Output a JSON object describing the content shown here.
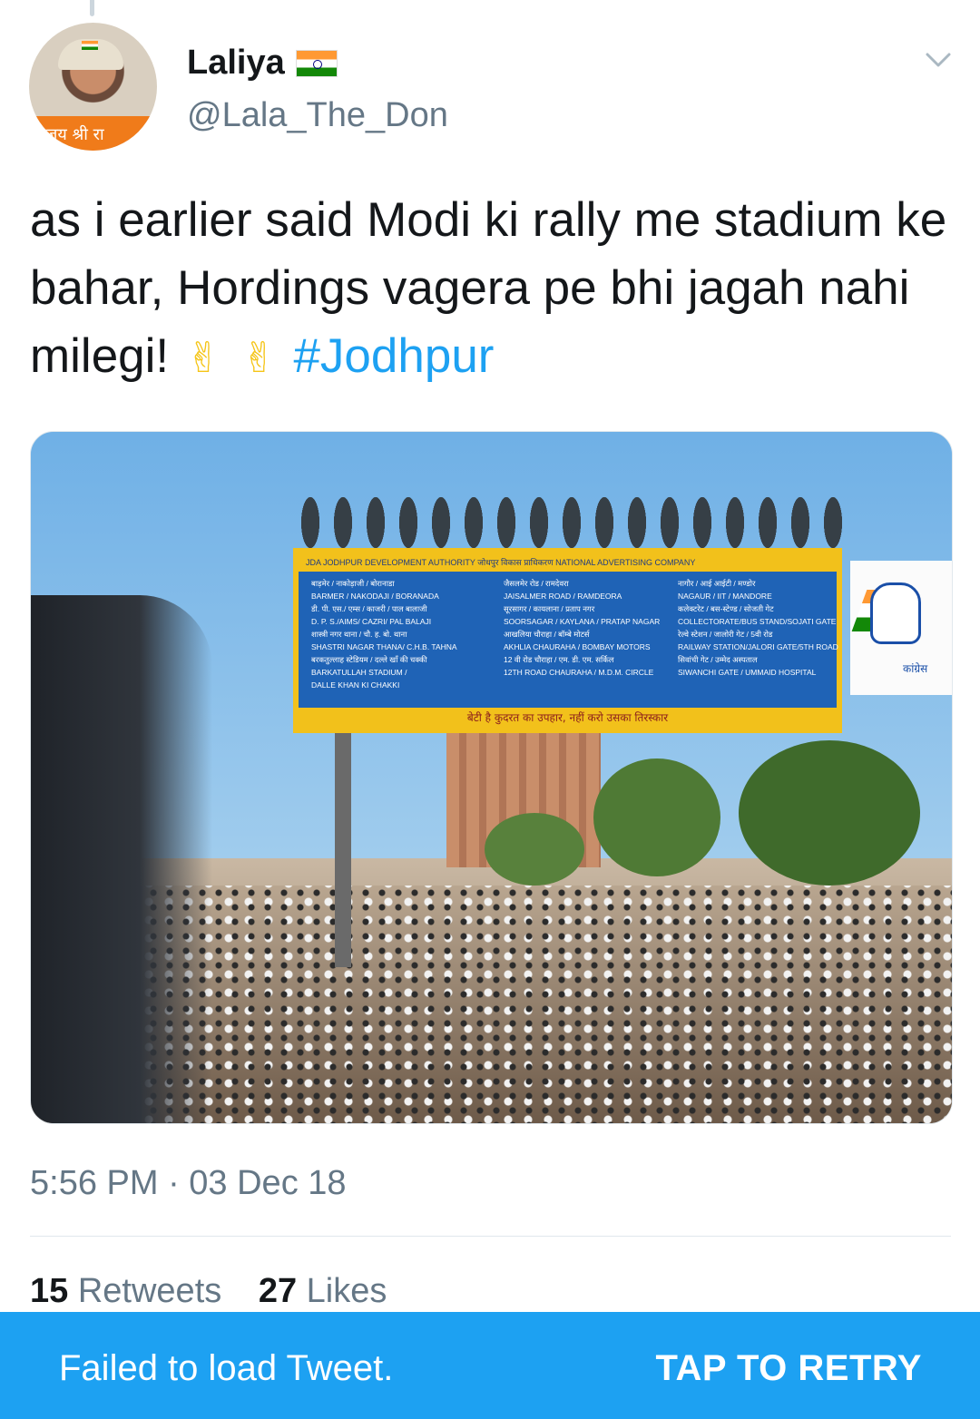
{
  "tweet": {
    "author": {
      "name": "Laliya",
      "handle": "@Lala_The_Don",
      "flag_icon": "india-flag-emoji",
      "avatar_band_text": "जय श्री रा"
    },
    "text_main": "as i earlier said Modi ki rally me stadium ke bahar, Hordings vagera pe bhi jagah nahi milegi!",
    "emoji_1": "✌",
    "emoji_2": "✌",
    "hashtag": "#Jodhpur",
    "timestamp": "5:56 PM · 03 Dec 18",
    "retweets_count": "15",
    "retweets_label": "Retweets",
    "likes_count": "27",
    "likes_label": "Likes"
  },
  "media": {
    "sign_header": "JDA  JODHPUR DEVELOPMENT AUTHORITY   जोधपुर विकास प्राधिकरण   NATIONAL ADVERTISING COMPANY",
    "sign_col1": [
      "बाड़मेर / नाकोड़ाजी / बोरानाडा",
      "BARMER / NAKODAJI / BORANADA",
      "डी. पी. एस./ एम्स / काजरी / पाल बालाजी",
      "D. P. S./AIMS/ CAZRI/ PAL  BALAJI",
      "शास्त्री नगर थाना / चौ. ह. बो. थाना",
      "SHASTRI NAGAR THANA/ C.H.B. TAHNA",
      "बरकतुल्लाह स्टेडियम / दल्ले खाँ की चक्की",
      "BARKATULLAH  STADIUM /",
      "DALLE  KHAN  KI  CHAKKI"
    ],
    "sign_col2": [
      "जैसलमेर रोड / रामदेवरा",
      "JAISALMER  ROAD / RAMDEORA",
      "सूरसागर / कायलाना / प्रताप नगर",
      "SOORSAGAR / KAYLANA / PRATAP NAGAR",
      "आखलिया चौराहा / बॉम्बे मोटर्स",
      "AKHLIA CHAURAHA / BOMBAY  MOTORS",
      "12 वी रोड चौराहा / एम. डी. एम. सर्किल",
      "12TH ROAD CHAURAHA / M.D.M. CIRCLE"
    ],
    "sign_col3": [
      "नागौर / आई आईटी / मण्डोर",
      "NAGAUR / IIT / MANDORE",
      "कलेक्टरेट / बस-स्टेण्ड / सोजती गेट",
      "COLLECTORATE/BUS STAND/SOJATI GATE",
      "रेल्वे स्टेशन / जालोरी गेट / 5वी रोड",
      "RAILWAY STATION/JALORI GATE/5TH ROAD",
      "सिवांची गेट / उम्मेद अस्पताल",
      "SIWANCHI  GATE / UMMAID HOSPITAL"
    ],
    "sign_footer": "बेटी है कुदरत का उपहार, नहीं करो उसका तिरस्कार",
    "banner_text": "कांग्रेस"
  },
  "snackbar": {
    "message": "Failed to load Tweet.",
    "action": "TAP TO RETRY"
  },
  "colors": {
    "accent": "#1da1f2",
    "secondary_text": "#657786",
    "primary_text": "#14171a"
  }
}
